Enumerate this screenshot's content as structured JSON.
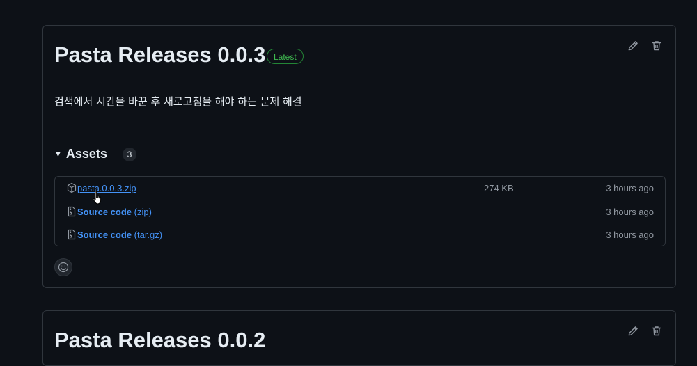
{
  "releases": [
    {
      "title": "Pasta Releases 0.0.3",
      "badge": "Latest",
      "notes": "검색에서 시간을 바꾼 후 새로고침을 해야 하는 문제 해결",
      "assets_label": "Assets",
      "assets_count": "3",
      "assets": [
        {
          "name": "pasta.0.0.3.zip",
          "name_extra": "",
          "size": "274 KB",
          "time": "3 hours ago",
          "icon": "package-icon"
        },
        {
          "name": "Source code",
          "name_extra": " (zip)",
          "size": "",
          "time": "3 hours ago",
          "icon": "file-zip-icon"
        },
        {
          "name": "Source code",
          "name_extra": " (tar.gz)",
          "size": "",
          "time": "3 hours ago",
          "icon": "file-zip-icon"
        }
      ]
    },
    {
      "title": "Pasta Releases 0.0.2"
    }
  ],
  "colors": {
    "background": "#0d1117",
    "border": "#30363d",
    "link": "#4493f8",
    "latest_badge": "#3fb950",
    "muted_text": "#9198a1"
  }
}
